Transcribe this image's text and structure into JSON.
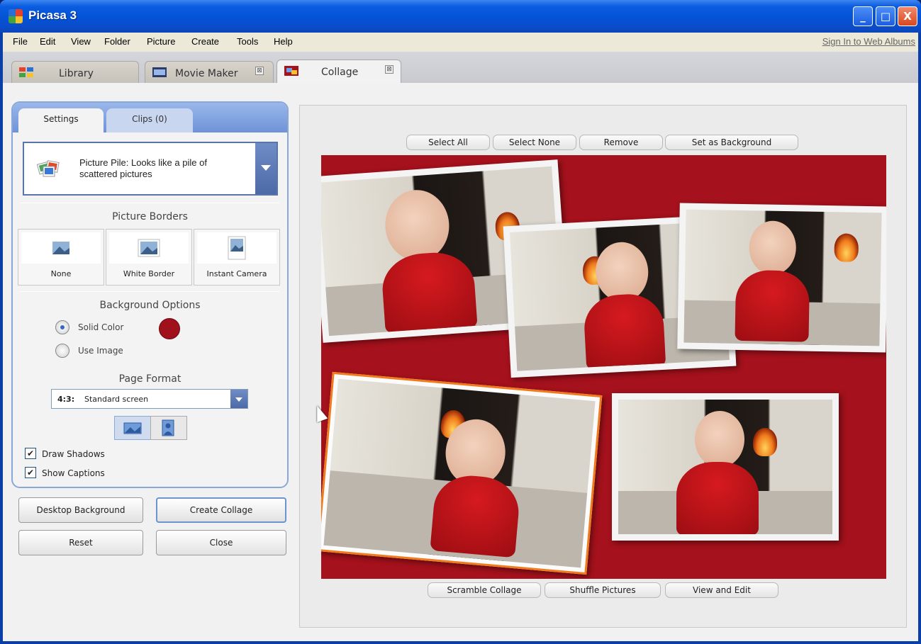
{
  "window": {
    "title": "Picasa 3",
    "minimize": "_",
    "maximize": "□",
    "close": "X"
  },
  "menu": {
    "items": [
      "File",
      "Edit",
      "View",
      "Folder",
      "Picture",
      "Create",
      "Tools",
      "Help"
    ],
    "sign_in": "Sign In to Web Albums"
  },
  "tabs": [
    {
      "label": "Library",
      "icon": "library-icon"
    },
    {
      "label": "Movie Maker",
      "icon": "movie-maker-icon"
    },
    {
      "label": "Collage",
      "icon": "collage-icon"
    }
  ],
  "tab_close_glyph": "⊠",
  "settings": {
    "tabs": {
      "settings": "Settings",
      "clips": "Clips (0)"
    },
    "collage_type": {
      "line1": "Picture Pile:  Looks like a pile of",
      "line2": "scattered pictures"
    },
    "picture_borders": {
      "title": "Picture Borders",
      "options": [
        "None",
        "White Border",
        "Instant Camera"
      ]
    },
    "background_options": {
      "title": "Background Options",
      "solid_color": "Solid Color",
      "use_image": "Use Image",
      "selected": "Solid Color",
      "color": "#a0111c"
    },
    "page_format": {
      "title": "Page Format",
      "ratio": "4:3:",
      "name": "Standard screen",
      "orientation": "landscape"
    },
    "checkboxes": {
      "draw_shadows": "Draw Shadows",
      "show_captions": "Show Captions",
      "draw_shadows_checked": true,
      "show_captions_checked": true
    },
    "check_glyph": "✔"
  },
  "actions": {
    "desktop_background": "Desktop Background",
    "create_collage": "Create Collage",
    "reset": "Reset",
    "close": "Close"
  },
  "canvas_toolbar": {
    "select_all": "Select All",
    "select_none": "Select None",
    "remove": "Remove",
    "set_as_background": "Set as Background"
  },
  "canvas_bottom": {
    "scramble_collage": "Scramble Collage",
    "shuffle_pictures": "Shuffle Pictures",
    "view_and_edit": "View and Edit"
  },
  "colors": {
    "collage_background": "#a5111c",
    "selection": "#f07a1c",
    "accent": "#6f93d8"
  }
}
